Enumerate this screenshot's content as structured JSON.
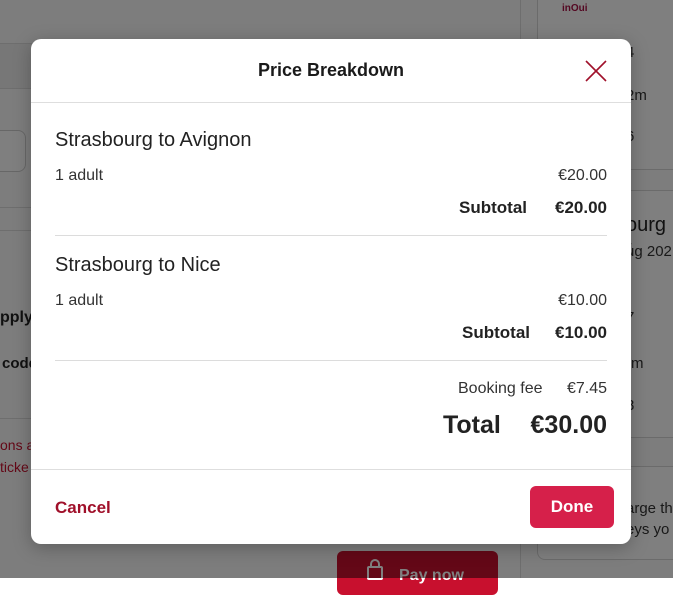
{
  "background": {
    "apply_fragment": "pply",
    "codes_fragment": "code",
    "link_fragment_1": "ons a",
    "link_fragment_2": "ticke",
    "card_logo": "inOui",
    "frag_a": "4",
    "frag_b": "2m",
    "frag_c": "6",
    "frag_d": "ourg t",
    "frag_e": "ug 202",
    "frag_f": "7",
    "frag_g": "m",
    "frag_h": "8",
    "frag_i": "arge th",
    "frag_j": "eys yo",
    "pay_label": "Pay now"
  },
  "modal": {
    "title": "Price Breakdown",
    "close_icon": "close-icon",
    "trips": [
      {
        "route": "Strasbourg to Avignon",
        "passenger": "1 adult",
        "price": "€20.00",
        "subtotal_label": "Subtotal",
        "subtotal_value": "€20.00"
      },
      {
        "route": "Strasbourg to Nice",
        "passenger": "1 adult",
        "price": "€10.00",
        "subtotal_label": "Subtotal",
        "subtotal_value": "€10.00"
      }
    ],
    "booking_fee_label": "Booking fee",
    "booking_fee_value": "€7.45",
    "total_label": "Total",
    "total_value": "€30.00",
    "cancel_label": "Cancel",
    "done_label": "Done"
  },
  "colors": {
    "accent": "#d6204a",
    "cancel_text": "#a0102a",
    "overlay": "rgba(0,0,0,0.5)"
  }
}
